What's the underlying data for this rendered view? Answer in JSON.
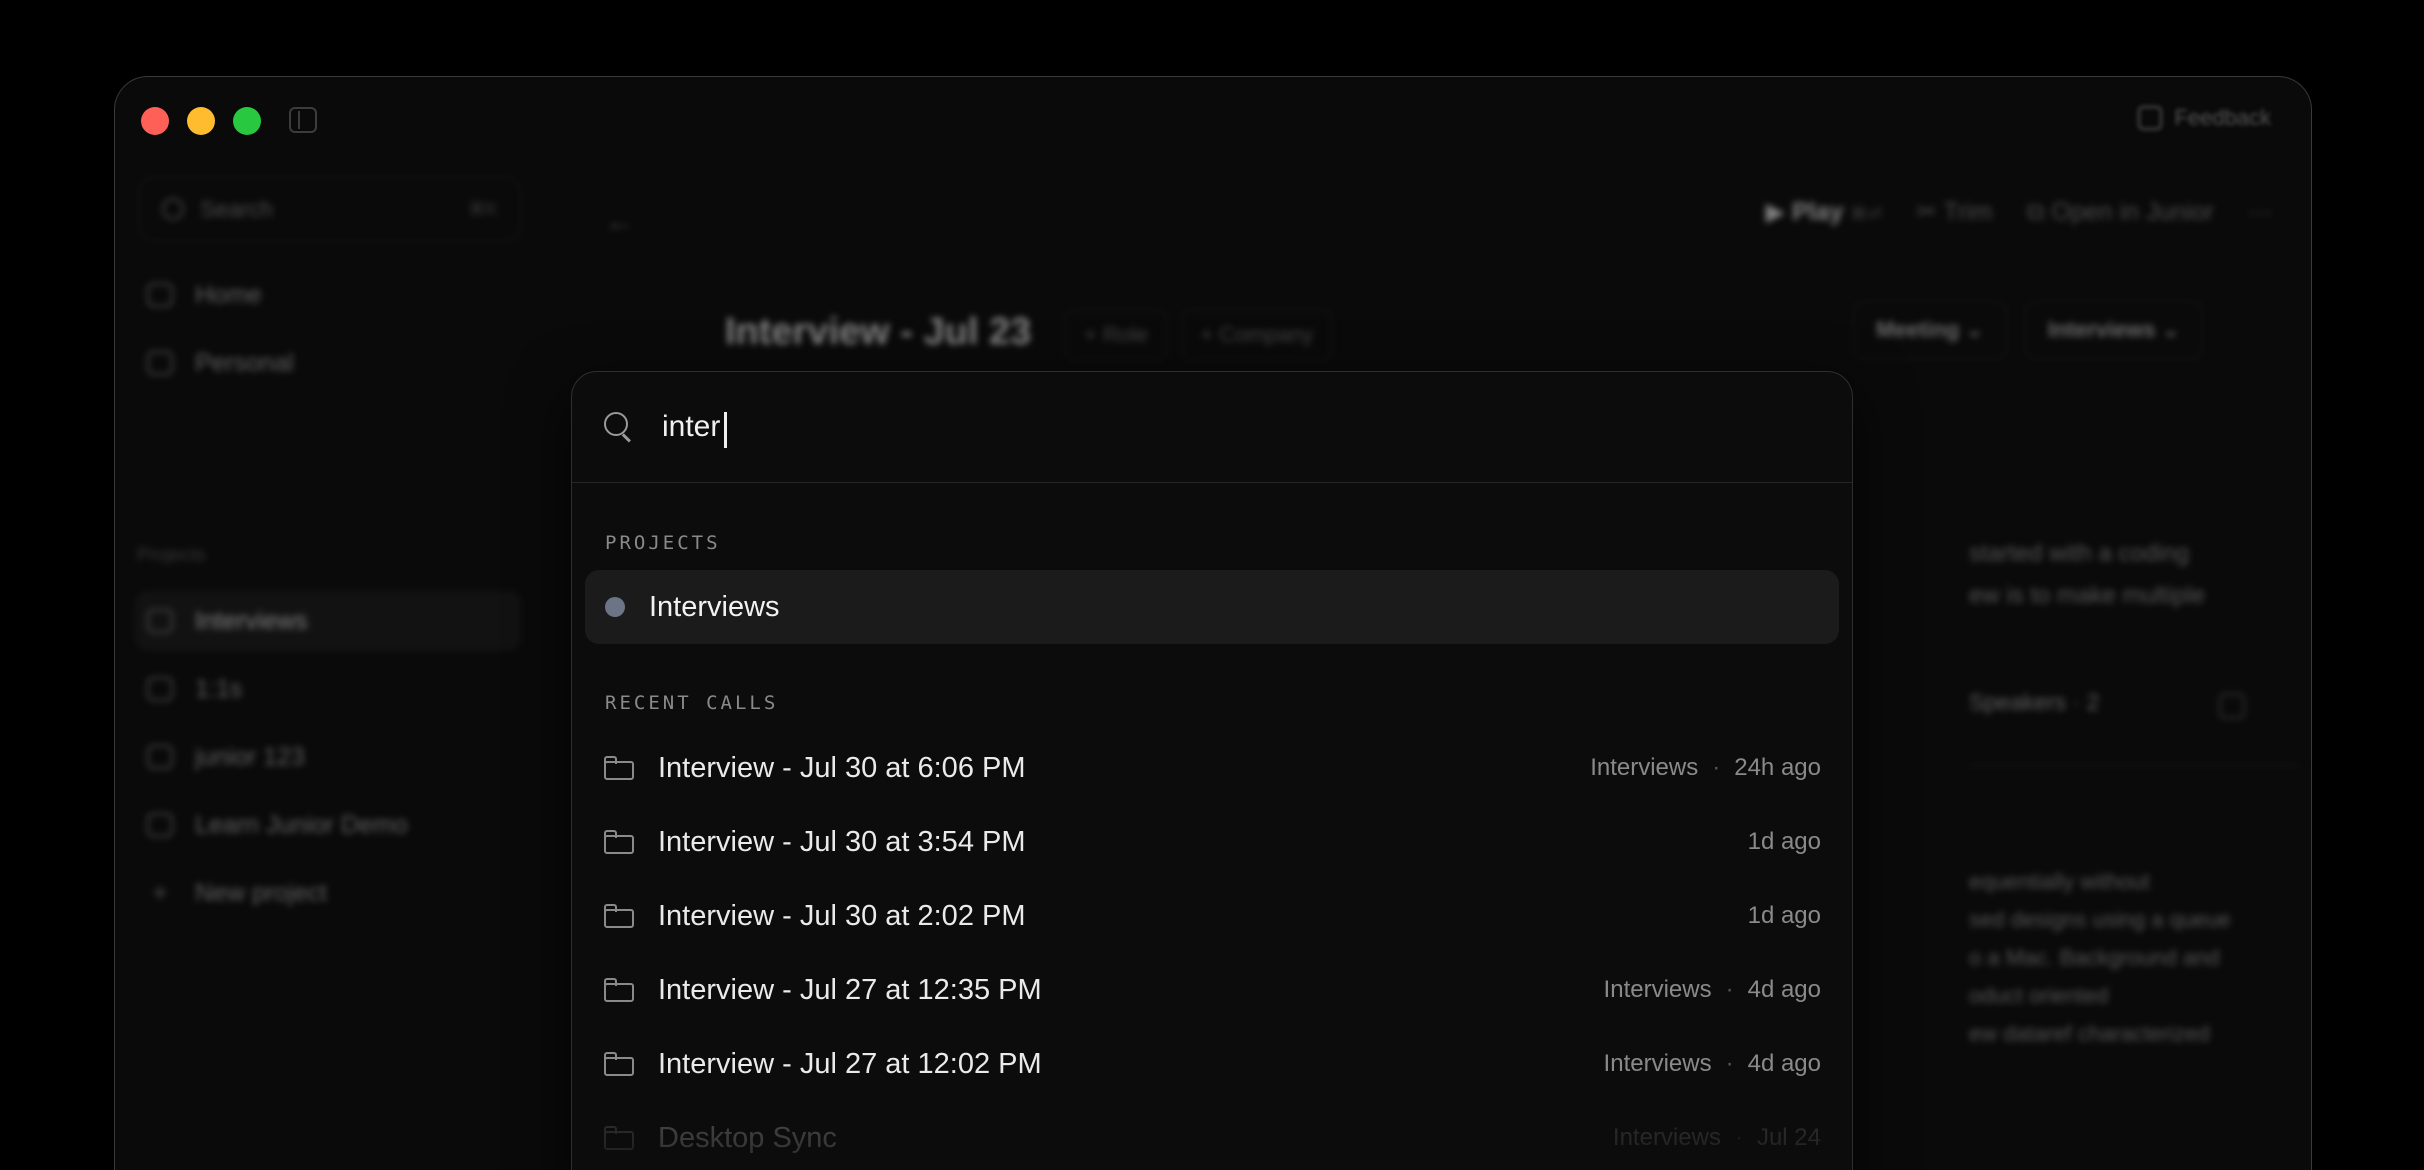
{
  "window": {
    "feedback_label": "Feedback"
  },
  "sidebar": {
    "search_placeholder": "Search",
    "search_shortcut": "⌘K",
    "nav": [
      {
        "label": "Home"
      },
      {
        "label": "Personal"
      }
    ],
    "projects_heading": "Projects",
    "projects": [
      {
        "label": "Interviews",
        "active": true
      },
      {
        "label": "1:1s"
      },
      {
        "label": "junior 123"
      },
      {
        "label": "Learn Junior Demo"
      }
    ],
    "new_project_label": "New project"
  },
  "main": {
    "back_label": "←",
    "toolbar": {
      "play_label": "Play",
      "play_shortcut": "⌘⏎",
      "trim_label": "Trim",
      "open_label": "Open in Junior",
      "more_label": "···"
    },
    "title": "Interview - Jul 23",
    "chips": [
      "+ Role",
      "+ Company"
    ],
    "selects": [
      "Meeting",
      "Interviews"
    ],
    "speakers_label": "Speakers · 2",
    "summary_fragments": [
      "started with a coding",
      "ew is to make multiple"
    ],
    "notes_fragments": [
      "equentially without",
      "sed designs using a queue",
      "o a Mac. Background and",
      "oduct oriented",
      "ew dataref characterized"
    ]
  },
  "palette": {
    "query": "inter",
    "projects_heading": "PROJECTS",
    "projects": [
      {
        "label": "Interviews",
        "color": "#6b7586"
      }
    ],
    "recent_heading": "RECENT CALLS",
    "calls": [
      {
        "name": "Interview - Jul 30 at 6:06 PM",
        "project": "Interviews",
        "time": "24h ago"
      },
      {
        "name": "Interview - Jul 30 at 3:54 PM",
        "project": "",
        "time": "1d ago"
      },
      {
        "name": "Interview - Jul 30 at 2:02 PM",
        "project": "",
        "time": "1d ago"
      },
      {
        "name": "Interview - Jul 27 at 12:35 PM",
        "project": "Interviews",
        "time": "4d ago"
      },
      {
        "name": "Interview - Jul 27 at 12:02 PM",
        "project": "Interviews",
        "time": "4d ago"
      },
      {
        "name": "Desktop Sync",
        "project": "Interviews",
        "time": "Jul 24"
      }
    ]
  }
}
